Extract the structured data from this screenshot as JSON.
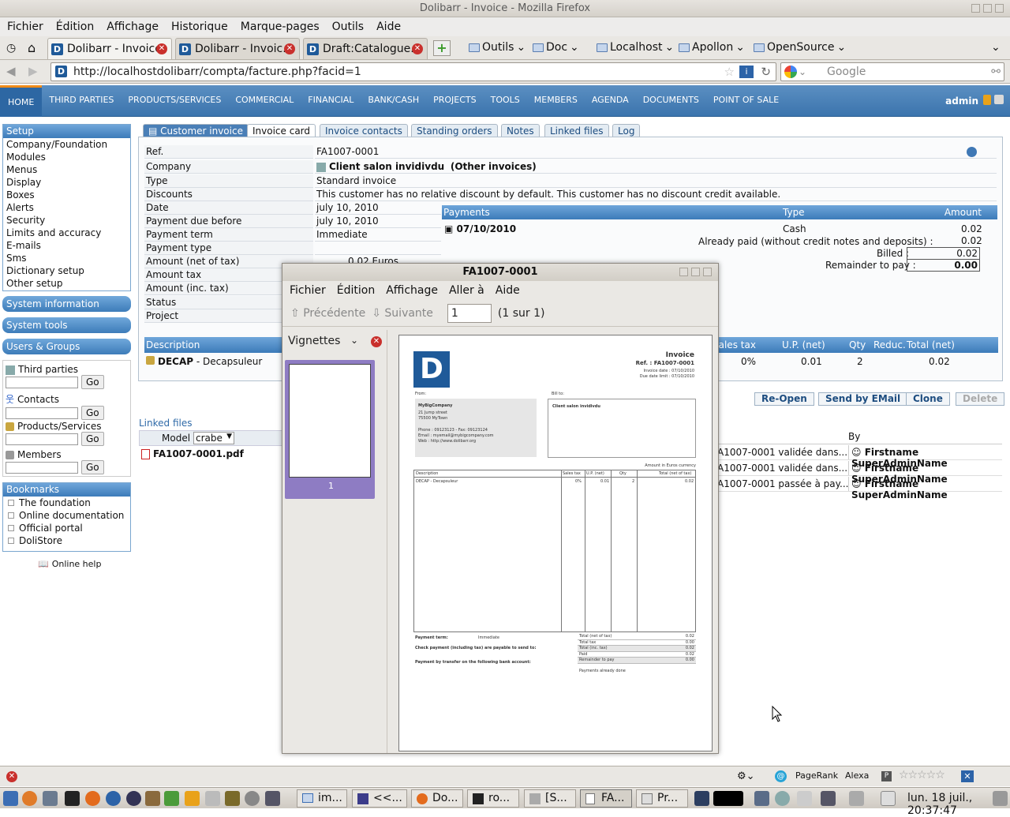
{
  "window": {
    "title": "Dolibarr - Invoice - Mozilla Firefox"
  },
  "menubar": [
    "Fichier",
    "Édition",
    "Affichage",
    "Historique",
    "Marque-pages",
    "Outils",
    "Aide"
  ],
  "tabs": [
    {
      "label": "Dolibarr - Invoice"
    },
    {
      "label": "Dolibarr - Invoic..."
    },
    {
      "label": "Draft:Catalogue..."
    }
  ],
  "bookmarks": [
    "Outils",
    "Doc",
    "Localhost",
    "Apollon",
    "OpenSource"
  ],
  "url": "http://localhostdolibarr/compta/facture.php?facid=1",
  "search_placeholder": "Google",
  "nav": {
    "items": [
      "HOME",
      "THIRD PARTIES",
      "PRODUCTS/SERVICES",
      "COMMERCIAL",
      "FINANCIAL",
      "BANK/CASH",
      "PROJECTS",
      "TOOLS",
      "MEMBERS",
      "AGENDA",
      "DOCUMENTS",
      "POINT OF SALE"
    ],
    "user": "admin"
  },
  "left": {
    "setup_title": "Setup",
    "setup_items": [
      "Company/Foundation",
      "Modules",
      "Menus",
      "Display",
      "Boxes",
      "Alerts",
      "Security",
      "Limits and accuracy",
      "E-mails",
      "Sms",
      "Dictionary setup",
      "Other setup"
    ],
    "sections": [
      "System information",
      "System tools",
      "Users & Groups"
    ],
    "searches": [
      "Third parties",
      "Contacts",
      "Products/Services",
      "Members"
    ],
    "go": "Go",
    "bookmarks_title": "Bookmarks",
    "bookmarks": [
      "The foundation",
      "Online documentation",
      "Official portal",
      "DoliStore"
    ],
    "help": "Online help"
  },
  "invoice_tabs": [
    "Customer invoice",
    "Invoice card",
    "Invoice contacts",
    "Standing orders",
    "Notes",
    "Linked files",
    "Log"
  ],
  "fields": [
    {
      "label": "Ref.",
      "value": "FA1007-0001"
    },
    {
      "label": "Company",
      "value": "Client salon invidivdu",
      "extra": "(Other invoices)"
    },
    {
      "label": "Type",
      "value": "Standard invoice"
    },
    {
      "label": "Discounts",
      "value": "This customer has no relative discount by default. This customer has no discount credit available."
    },
    {
      "label": "Date",
      "value": "july 10, 2010"
    },
    {
      "label": "Payment due before",
      "value": "july 10, 2010"
    },
    {
      "label": "Payment term",
      "value": "Immediate"
    },
    {
      "label": "Payment type",
      "value": ""
    },
    {
      "label": "Amount (net of tax)",
      "value": "0.02",
      "unit": "Euros"
    },
    {
      "label": "Amount tax",
      "value": ""
    },
    {
      "label": "Amount (inc. tax)",
      "value": ""
    },
    {
      "label": "Status",
      "value": ""
    },
    {
      "label": "Project",
      "value": ""
    }
  ],
  "payments": {
    "headers": [
      "Payments",
      "Type",
      "Amount"
    ],
    "date": "07/10/2010",
    "type": "Cash",
    "amount": "0.02",
    "already_paid_label": "Already paid (without credit notes and deposits) :",
    "already_paid": "0.02",
    "billed_label": "Billed :",
    "billed": "0.02",
    "remainder_label": "Remainder to pay :",
    "remainder": "0.00"
  },
  "lines": {
    "headers": [
      "Description",
      "Sales tax",
      "U.P. (net)",
      "Qty",
      "Reduc.",
      "Total (net)"
    ],
    "row": {
      "ref": "DECAP",
      "desc": "- Decapsuleur",
      "tax": "0%",
      "up": "0.01",
      "qty": "2",
      "total": "0.02"
    }
  },
  "actions": [
    "Re-Open",
    "Send by EMail",
    "Clone",
    "Delete"
  ],
  "linked": {
    "title": "Linked files",
    "model_label": "Model",
    "model": "crabe",
    "file": "FA1007-0001.pdf",
    "by_header": "By",
    "events": [
      {
        "text": "A1007-0001 validée dans...",
        "by": "Firstname SuperAdminName"
      },
      {
        "text": "A1007-0001 validée dans...",
        "by": "Firstname SuperAdminName"
      },
      {
        "text": "A1007-0001 passée à pay...",
        "by": "Firstname SuperAdminName"
      }
    ]
  },
  "viewer": {
    "title": "FA1007-0001",
    "menu": [
      "Fichier",
      "Édition",
      "Affichage",
      "Aller à",
      "Aide"
    ],
    "prev": "Précédente",
    "next": "Suivante",
    "page": "1",
    "page_of": "(1 sur 1)",
    "sidebar": "Vignettes",
    "thumb_num": "1",
    "doc": {
      "heading": "Invoice",
      "ref": "Ref. : FA1007-0001",
      "date": "Invoice date : 07/10/2010",
      "due": "Due date limit : 07/10/2010",
      "from": "From:",
      "billto": "Bill to:",
      "company": "MyBigCompany",
      "addr1": "21 Jump street",
      "addr2": "75500 MyTown",
      "phone": "Phone : 09123123 - Fax: 09123124",
      "email": "Email : myemail@mybigcompany.com",
      "web": "Web : http://www.dolibarr.org",
      "client": "Client salon invidivdu",
      "currency": "Amount in Euros currency",
      "cols": [
        "Description",
        "Sales tax",
        "U.P. (net)",
        "Qty",
        "Total (net of tax)"
      ],
      "line": [
        "DECAP - Decapsuleur",
        "0%",
        "0.01",
        "2",
        "0.02"
      ],
      "payterm_label": "Payment term:",
      "payterm": "Immediate",
      "check": "Check payment (including tax) are payable to send to:",
      "transfer": "Payment by transfer on the following bank account:",
      "totals": [
        [
          "Total (net of tax)",
          "0.02"
        ],
        [
          "Total tax",
          "0.00"
        ],
        [
          "Total (inc. tax)",
          "0.02"
        ],
        [
          "Paid",
          "0.02"
        ],
        [
          "Remainder to pay",
          "0.00"
        ]
      ],
      "paid_done": "Payments already done"
    }
  },
  "status": {
    "pagerank": "PageRank",
    "alexa": "Alexa"
  },
  "taskbar": {
    "items": [
      "im...",
      "<<...",
      "Do...",
      "ro...",
      "[S...",
      "FA...",
      "Pr..."
    ],
    "clock": "lun. 18 juil., 20:37:47"
  }
}
